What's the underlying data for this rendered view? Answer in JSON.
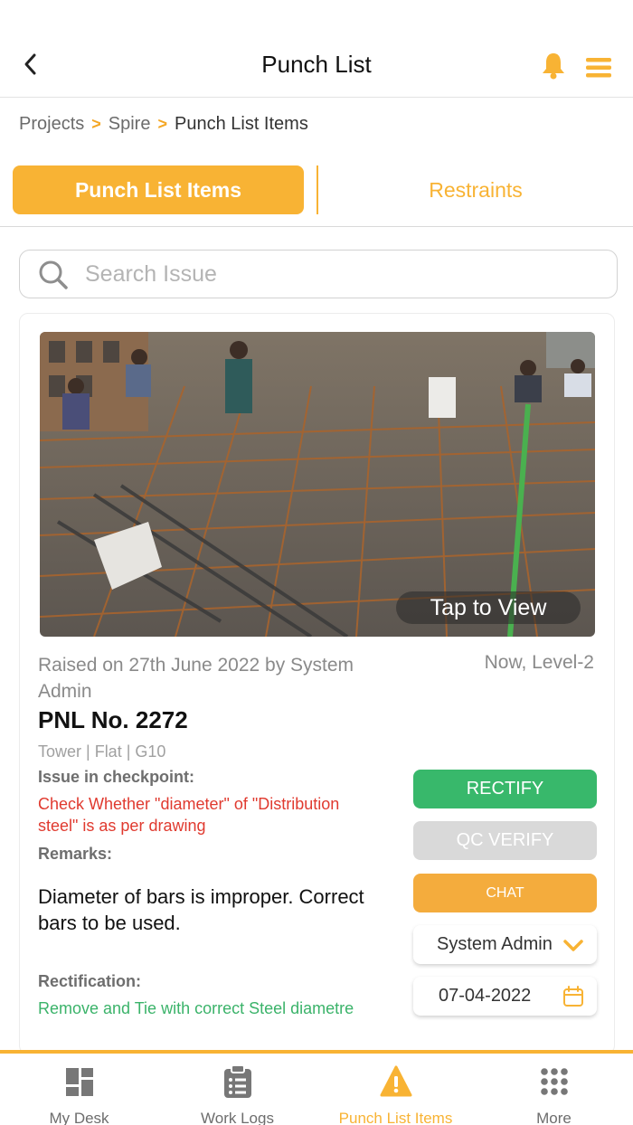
{
  "header": {
    "title": "Punch List"
  },
  "breadcrumb": {
    "items": [
      "Projects",
      "Spire",
      "Punch List Items"
    ],
    "separator": ">"
  },
  "tabs": {
    "active": "Punch List Items",
    "inactive": "Restraints"
  },
  "search": {
    "placeholder": "Search Issue"
  },
  "card": {
    "photo_overlay": "Tap to View",
    "raised_text": "Raised on 27th June 2022 by System Admin",
    "level": "Now, Level-2",
    "pnl_number": "PNL No. 2272",
    "location": "Tower | Flat | G10",
    "issue_label": "Issue in checkpoint:",
    "issue_text": "Check Whether \"diameter\" of \"Distribution steel\" is as per drawing",
    "remarks_label": "Remarks:",
    "remarks_text": "Diameter of bars is improper. Correct bars to be used.",
    "rectification_label": "Rectification:",
    "rectification_text": "Remove and Tie with correct Steel diametre",
    "buttons": {
      "rectify": "RECTIFY",
      "qc_verify": "QC VERIFY",
      "chat": "CHAT"
    },
    "assignee": "System Admin",
    "date": "07-04-2022"
  },
  "bottom_nav": [
    {
      "label": "My Desk",
      "icon": "dashboard-icon",
      "active": false
    },
    {
      "label": "Work Logs",
      "icon": "clipboard-icon",
      "active": false
    },
    {
      "label": "Punch List Items",
      "icon": "warning-icon",
      "active": true
    },
    {
      "label": "More",
      "icon": "grid-dots-icon",
      "active": false
    }
  ],
  "colors": {
    "accent": "#f8b334",
    "rectify": "#38b86b",
    "issue": "#e03a2f",
    "rectification": "#3bb36a",
    "disabled": "#d9d9d9"
  }
}
